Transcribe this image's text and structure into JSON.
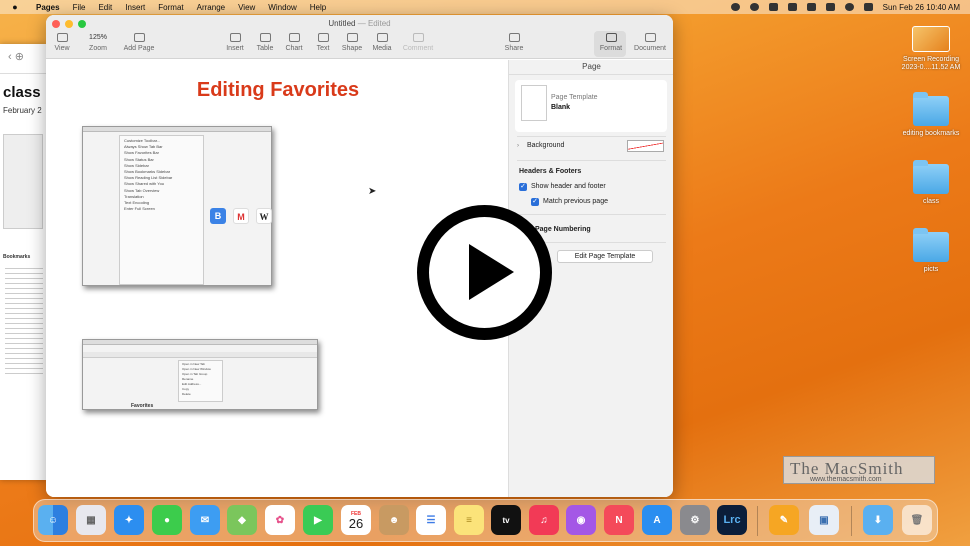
{
  "menubar": {
    "app": "Pages",
    "items": [
      "File",
      "Edit",
      "Insert",
      "Format",
      "Arrange",
      "View",
      "Window",
      "Help"
    ],
    "clock": "Sun Feb 26  10:40 AM"
  },
  "background_doc": {
    "title": "class",
    "date": "February 2",
    "bookmarks_heading": "Bookmarks"
  },
  "window": {
    "title": "Untitled",
    "edited": "— Edited",
    "toolbar": {
      "view": "View",
      "zoom_value": "125%",
      "zoom": "Zoom",
      "add_page": "Add Page",
      "insert": "Insert",
      "table": "Table",
      "chart": "Chart",
      "text": "Text",
      "shape": "Shape",
      "media": "Media",
      "comment": "Comment",
      "share": "Share",
      "format": "Format",
      "document": "Document"
    }
  },
  "document": {
    "heading": "Editing Favorites",
    "fav_label": "Favorites",
    "menu_lines": [
      "Customize Toolbar...",
      "Always Show Tab Bar",
      "Show Favorites Bar",
      "Show Status Bar",
      "Show Sidebar",
      "Show Bookmarks Sidebar",
      "Show Reading List Sidebar",
      "Show Shared with You",
      "Show Tab Overview",
      "Translation",
      "Text Encoding",
      "Enter Full Screen"
    ],
    "submenu_lines": [
      "Open in New Tab",
      "Open in New Window",
      "Open in Tab Group",
      "Rename",
      "Edit Address...",
      "Copy",
      "Delete"
    ],
    "tile_labels": [
      "B",
      "M",
      "W"
    ]
  },
  "sidebar": {
    "header": "Page",
    "page_template_label": "Page Template",
    "page_template_value": "Blank",
    "background": "Background",
    "headers_footers": "Headers & Footers",
    "show_header_footer": "Show header and footer",
    "match_previous": "Match previous page",
    "page_numbering": "Page Numbering",
    "edit_template_button": "Edit Page Template"
  },
  "desktop": {
    "recording_label": "Screen Recording 2023-0....11.52 AM",
    "folders": [
      "editing bookmarks",
      "class",
      "picts"
    ]
  },
  "watermark": {
    "title": "The MacSmith",
    "url": "www.themacsmith.com"
  },
  "dock": {
    "calendar_month": "FEB",
    "calendar_day": "26",
    "lrc": "Lrc"
  },
  "colors": {
    "heading_red": "#d93a1a",
    "accent_blue": "#2a6fd9"
  }
}
